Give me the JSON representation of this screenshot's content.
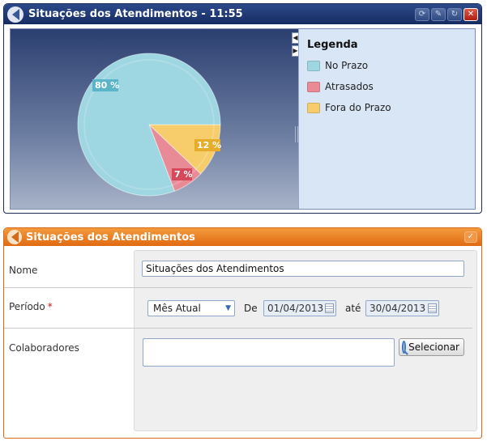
{
  "chart_window": {
    "title": "Situações dos Atendimentos - 11:55",
    "buttons": {
      "refresh_icon": "refresh-icon",
      "edit_icon": "pencil-icon",
      "close_icon": "close-icon"
    },
    "legend_title": "Legenda"
  },
  "chart_data": {
    "type": "pie",
    "categories": [
      "No Prazo",
      "Atrasados",
      "Fora do Prazo"
    ],
    "values": [
      80,
      7,
      12
    ],
    "labels": [
      "80 %",
      "7 %",
      "12 %"
    ],
    "colors": [
      "#9ed6e1",
      "#e98b96",
      "#f6cd6a"
    ],
    "label_colors": [
      "#5ab5c9",
      "#d6495b",
      "#e6ad2b"
    ],
    "legend_position": "right"
  },
  "form_window": {
    "title": "Situações dos Atendimentos",
    "fields": {
      "nome_label": "Nome",
      "nome_value": "Situações dos Atendimentos",
      "periodo_label": "Período",
      "periodo_required": "*",
      "periodo_select": "Mês Atual",
      "de_label": "De",
      "date_from": "01/04/2013",
      "ate_label": "até",
      "date_to": "30/04/2013",
      "colaboradores_label": "Colaboradores",
      "colaboradores_value": "",
      "selecionar_button": "Selecionar"
    }
  }
}
